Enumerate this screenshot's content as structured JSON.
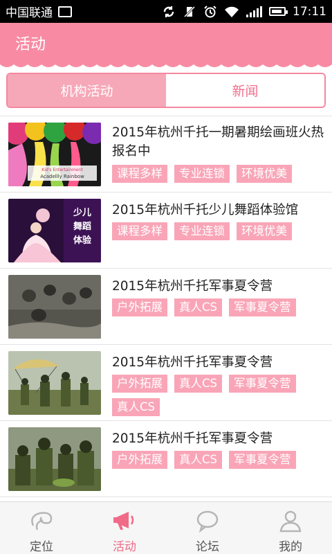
{
  "status_bar": {
    "carrier": "中国联通",
    "time": "17:11"
  },
  "app_bar": {
    "title": "活动"
  },
  "tabs": [
    {
      "label": "机构活动",
      "active": true
    },
    {
      "label": "新闻",
      "active": false
    }
  ],
  "items": [
    {
      "title": "2015年杭州千托一期暑期绘画班火热报名中",
      "tags": [
        "课程多样",
        "专业连锁",
        "环境优美"
      ],
      "thumb_caption": "Acadellly Rainbow"
    },
    {
      "title": "2015年杭州千托少儿舞蹈体验馆",
      "tags": [
        "课程多样",
        "专业连锁",
        "环境优美"
      ],
      "thumb_caption": "少儿舞蹈体验"
    },
    {
      "title": "2015年杭州千托军事夏令营",
      "tags": [
        "户外拓展",
        "真人CS",
        "军事夏令营"
      ]
    },
    {
      "title": "2015年杭州千托军事夏令营",
      "tags": [
        "户外拓展",
        "真人CS",
        "军事夏令营",
        "真人CS"
      ]
    },
    {
      "title": "2015年杭州千托军事夏令营",
      "tags": [
        "户外拓展",
        "真人CS",
        "军事夏令营"
      ]
    }
  ],
  "bottom_nav": [
    {
      "label": "定位",
      "icon": "location-swirl-icon",
      "active": false
    },
    {
      "label": "活动",
      "icon": "megaphone-icon",
      "active": true
    },
    {
      "label": "论坛",
      "icon": "chat-bubble-icon",
      "active": false
    },
    {
      "label": "我的",
      "icon": "person-icon",
      "active": false
    }
  ],
  "colors": {
    "accent": "#f88ba3",
    "tag": "#f9a5b7",
    "active_nav": "#f06b88"
  }
}
